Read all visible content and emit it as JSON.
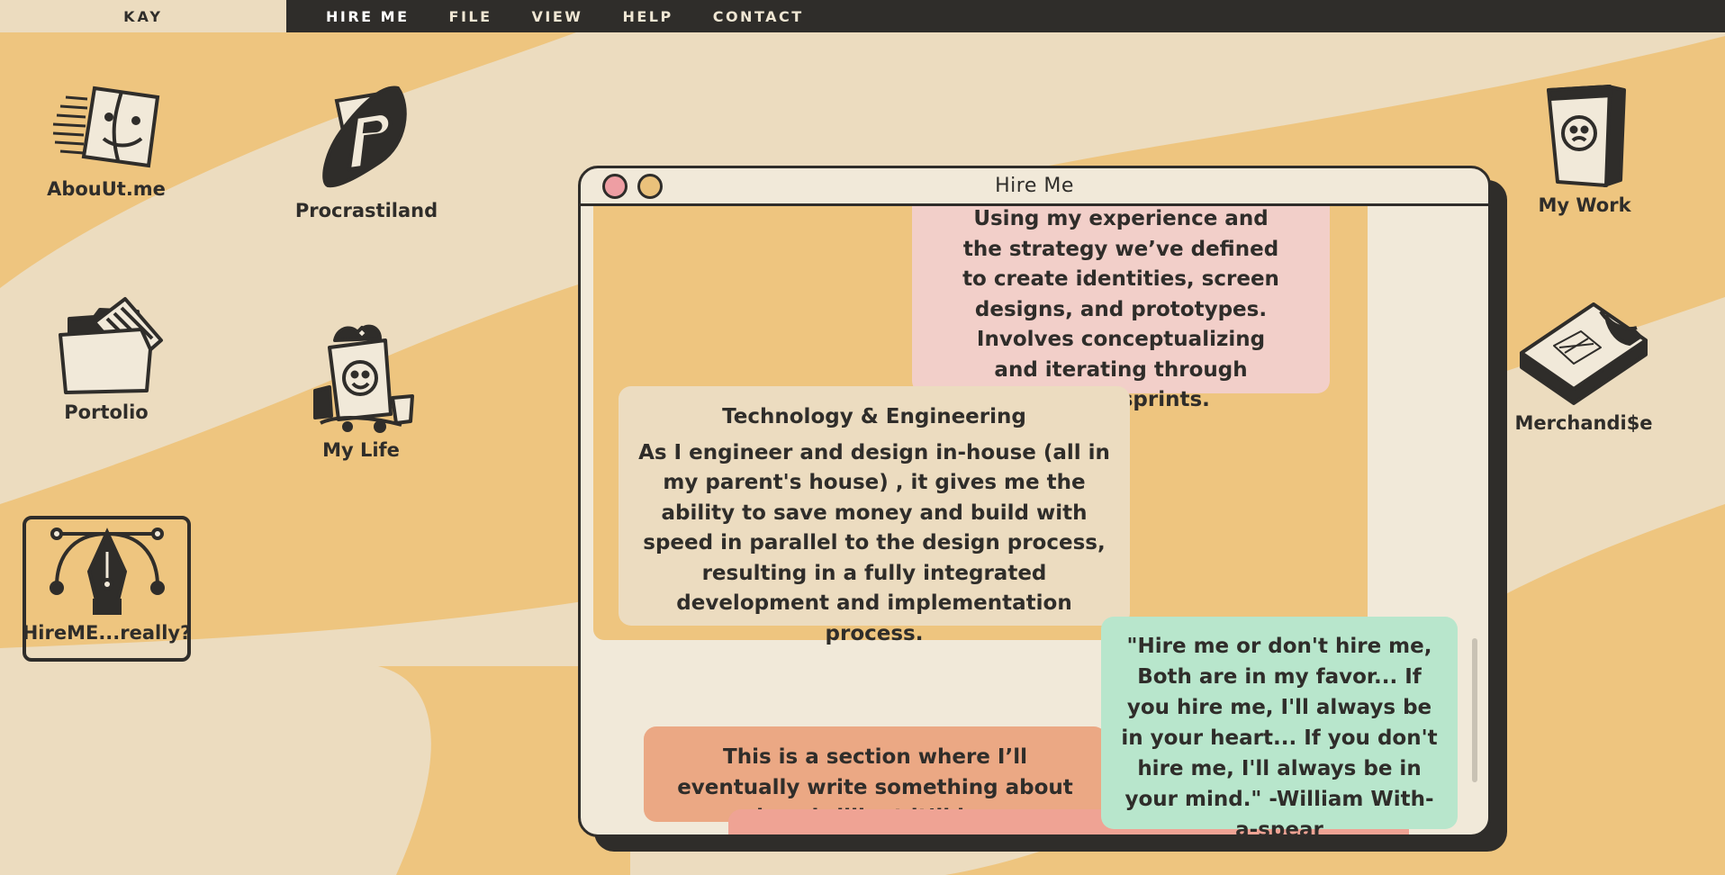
{
  "menubar": {
    "brand": "KAY",
    "items": [
      "HIRE ME",
      "FILE",
      "VIEW",
      "HELP",
      "CONTACT"
    ]
  },
  "desktop": {
    "left_icons": [
      {
        "label": "AbouUt.me",
        "icon": "finder-face-icon"
      },
      {
        "label": "Procrastiland",
        "icon": "paypal-p-icon"
      },
      {
        "label": "Portolio",
        "icon": "folder-icon"
      },
      {
        "label": "My Life",
        "icon": "popcorn-bucket-icon"
      },
      {
        "label": "HireME...really?",
        "icon": "pen-tool-icon"
      }
    ],
    "right_icons": [
      {
        "label": "My Work",
        "icon": "cup-icon"
      },
      {
        "label": "Merchandi$e",
        "icon": "tshirt-box-icon"
      }
    ]
  },
  "window": {
    "title": "Hire Me",
    "cards": {
      "design_text": "Using my experience and the strategy we’ve defined to create identities, screen designs, and prototypes. Involves conceptualizing and iterating through weekly sprints.",
      "tech_title": "Technology & Engineering",
      "tech_text": "As I engineer and design in-house (all in my parent's house) , it gives me the ability to save money and build with speed in parallel to the design process, resulting in a fully integrated development and implementation process.",
      "quote_text": "\"Hire me or don't hire me, Both are in my favor... If you hire me, I'll always be in your heart... If you don't hire me, I'll always be in your mind.\" -William With-a-spear",
      "brilliant_text": "This is a section where I’ll eventually write something about how brilliant it’ll be."
    }
  },
  "colors": {
    "background": "#ecd9b4",
    "swoosh": "#eec57f",
    "ink": "#2f2d2a",
    "pink_card": "#f2cfc9",
    "beige_card": "#ecdcc0",
    "mint_card": "#b8e6cc",
    "salmon_card": "#eba884",
    "orange_panel": "#eec57f"
  }
}
